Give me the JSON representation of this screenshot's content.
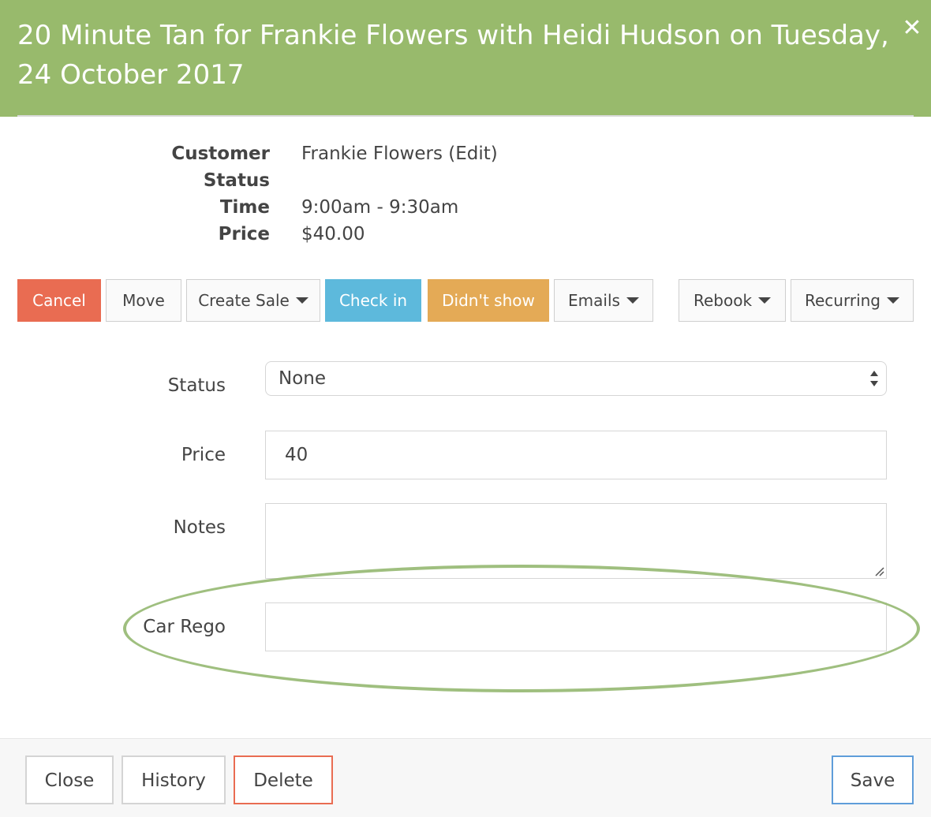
{
  "header": {
    "title": "20 Minute Tan for Frankie Flowers with Heidi Hudson on Tuesday, 24 October 2017",
    "close_icon": "close-x-icon"
  },
  "summary": {
    "customer_label": "Customer",
    "customer_value": "Frankie Flowers (Edit)",
    "status_label": "Status",
    "status_value": "",
    "time_label": "Time",
    "time_value": "9:00am - 9:30am",
    "price_label": "Price",
    "price_value": "$40.00"
  },
  "actions": {
    "cancel": "Cancel",
    "move": "Move",
    "create_sale": "Create Sale",
    "check_in": "Check in",
    "didnt_show": "Didn't show",
    "emails": "Emails",
    "rebook": "Rebook",
    "recurring": "Recurring"
  },
  "form": {
    "status_label": "Status",
    "status_value": "None",
    "price_label": "Price",
    "price_value": "40",
    "notes_label": "Notes",
    "notes_value": "",
    "car_rego_label": "Car Rego",
    "car_rego_value": ""
  },
  "footer": {
    "close": "Close",
    "history": "History",
    "delete": "Delete",
    "save": "Save"
  },
  "colors": {
    "header_bg": "#98ba6c",
    "cancel": "#e96c52",
    "check_in": "#5db9dc",
    "didnt_show": "#e4aa56",
    "save": "#5f9dda",
    "highlight": "#9fbf7f"
  }
}
